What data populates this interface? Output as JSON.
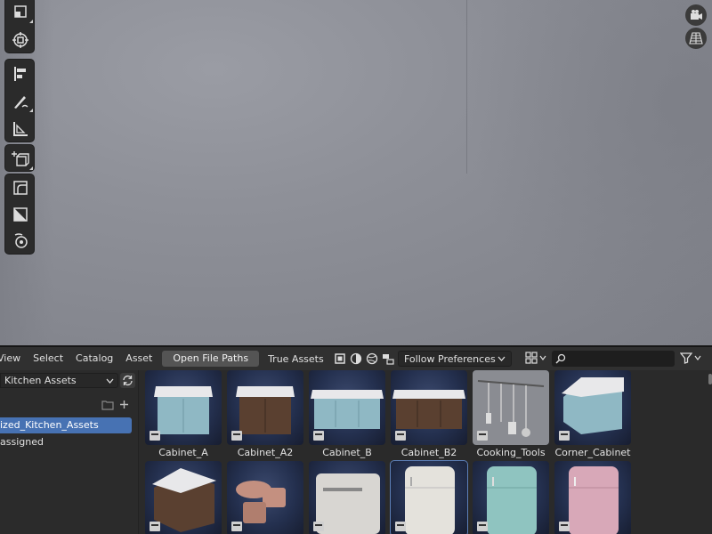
{
  "header": {
    "menus": [
      "View",
      "Select",
      "Catalog",
      "Asset"
    ],
    "open_file_paths": "Open File Paths",
    "true_assets": "True Assets",
    "import_method": "Follow Preferences",
    "search_placeholder": ""
  },
  "sidebar": {
    "library": "Kitchen Assets",
    "categories": [
      {
        "label": "ized_Kitchen_Assets",
        "selected": true
      },
      {
        "label": "assigned",
        "selected": false
      }
    ]
  },
  "assets": [
    {
      "label": "Cabinet_A",
      "kind": "cabinet-blue"
    },
    {
      "label": "Cabinet_A2",
      "kind": "cabinet-wood"
    },
    {
      "label": "Cabinet_B",
      "kind": "cabinet-long-blue"
    },
    {
      "label": "Cabinet_B2",
      "kind": "cabinet-long-wood"
    },
    {
      "label": "Cooking_Tools",
      "kind": "tools"
    },
    {
      "label": "Corner_Cabinet",
      "kind": "corner"
    },
    {
      "label": "",
      "kind": "corner-wood"
    },
    {
      "label": "",
      "kind": "boards"
    },
    {
      "label": "",
      "kind": "oven"
    },
    {
      "label": "",
      "kind": "fridge-white"
    },
    {
      "label": "",
      "kind": "fridge-teal"
    },
    {
      "label": "",
      "kind": "fridge-pink"
    }
  ],
  "colors": {
    "accent": "#4772b3",
    "viewport_bg": "#8e9098",
    "panel_bg": "#2a2a2a"
  },
  "icons": {
    "viewport_tools": [
      "scale-icon",
      "transform-icon",
      "align-icon",
      "annotate-icon",
      "measure-icon",
      "add-cube-icon",
      "bevel-icon",
      "knife-icon",
      "spin-icon"
    ],
    "gizmos": [
      "camera-icon",
      "grid-perspective-icon"
    ]
  }
}
